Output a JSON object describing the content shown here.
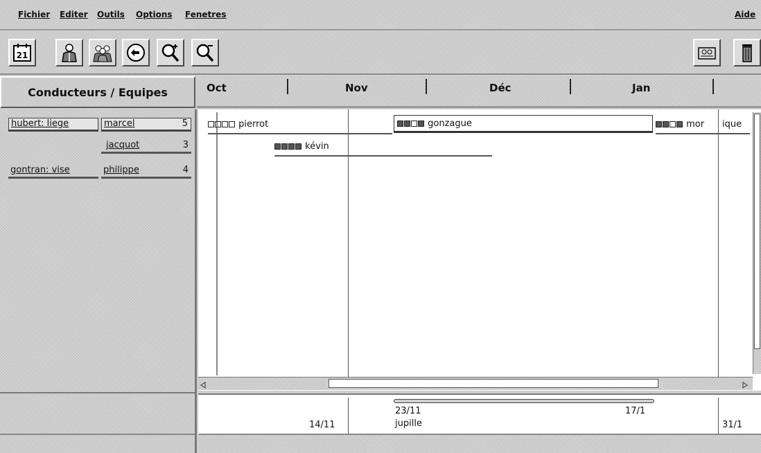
{
  "menu": {
    "fichier": "Fichier",
    "editer": "Editer",
    "outils": "Outils",
    "options": "Options",
    "fenetres": "Fenetres",
    "aide": "Aide"
  },
  "toolbar": {
    "calendar_label": "21"
  },
  "left": {
    "header": "Conducteurs / Equipes",
    "rows": [
      {
        "team": "hubert: liege",
        "member": "marcel",
        "count": "5"
      },
      {
        "team": "",
        "member": "jacquot",
        "count": "3"
      },
      {
        "team": "gontran: vise",
        "member": "philippe",
        "count": "4"
      }
    ]
  },
  "timeline": {
    "months": [
      "Oct",
      "Nov",
      "Déc",
      "Jan"
    ],
    "bars": [
      {
        "label": "pierrot"
      },
      {
        "label": "gonzague"
      },
      {
        "label": "mor"
      },
      {
        "label": "ique"
      },
      {
        "label": "kévin"
      }
    ],
    "footer": {
      "dates": [
        "14/11",
        "23/11",
        "17/1",
        "31/1"
      ],
      "sublabel": "jupille"
    }
  },
  "colors": {
    "panel": "#d4d4d4",
    "canvas": "#ffffff",
    "line": "#555555"
  }
}
